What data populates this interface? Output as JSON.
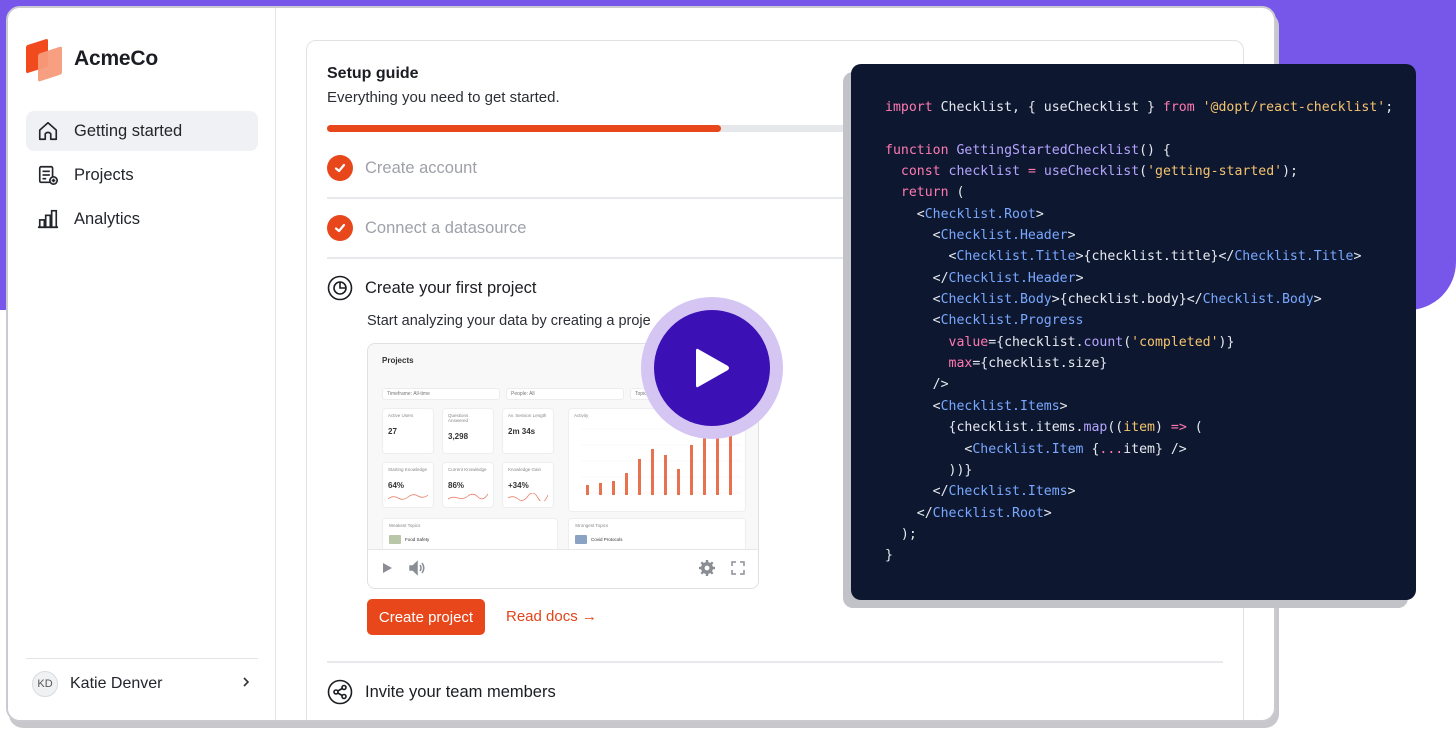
{
  "brand": {
    "name": "AcmeCo",
    "primary_color": "#e8471b",
    "accent_purple": "#7757ea"
  },
  "sidebar": {
    "items": [
      {
        "label": "Getting started",
        "icon": "home-icon",
        "active": true
      },
      {
        "label": "Projects",
        "icon": "document-list-icon",
        "active": false
      },
      {
        "label": "Analytics",
        "icon": "bar-chart-icon",
        "active": false
      }
    ],
    "user": {
      "initials": "KD",
      "name": "Katie Denver"
    }
  },
  "setup": {
    "title": "Setup guide",
    "subtitle": "Everything you need to get started.",
    "progress_fraction": 0.44,
    "steps": [
      {
        "label": "Create account",
        "status": "done"
      },
      {
        "label": "Connect a datasource",
        "status": "done"
      },
      {
        "label": "Create your first project",
        "status": "current",
        "description": "Start analyzing your data by creating a proje"
      },
      {
        "label": "Invite your team members",
        "status": "todo"
      }
    ],
    "primary_button": "Create project",
    "docs_link": "Read docs →"
  },
  "video": {
    "preview": {
      "title": "Projects",
      "filters": [
        "Timeframe: All-time",
        "People: All",
        "Topic"
      ],
      "stats": [
        {
          "label": "Active Users",
          "value": "27"
        },
        {
          "label": "Questions Answered",
          "value": "3,298"
        },
        {
          "label": "Av. Session Length",
          "value": "2m 34s"
        },
        {
          "label": "Starting Knowledge",
          "value": "64%"
        },
        {
          "label": "Current Knowledge",
          "value": "86%"
        },
        {
          "label": "Knowledge Gain",
          "value": "+34%"
        }
      ],
      "activity_label": "Activity",
      "weakest_label": "Weakest Topics",
      "weakest_item": "Food Safety",
      "strongest_label": "Strongest Topics",
      "strongest_item": "Covid Protocols"
    },
    "controls": [
      "play-icon",
      "volume-icon",
      "settings-icon",
      "fullscreen-icon"
    ]
  },
  "code_lines": [
    [
      [
        "kw",
        "import"
      ],
      [
        "pl",
        " Checklist, { useChecklist } "
      ],
      [
        "kw",
        "from"
      ],
      [
        "pl",
        " "
      ],
      [
        "str",
        "'@dopt/react-checklist'"
      ],
      [
        "pl",
        ";"
      ]
    ],
    [],
    [
      [
        "kw",
        "function"
      ],
      [
        "pl",
        " "
      ],
      [
        "fn",
        "GettingStartedChecklist"
      ],
      [
        "pl",
        "() {"
      ]
    ],
    [
      [
        "pl",
        "  "
      ],
      [
        "kw",
        "const"
      ],
      [
        "pl",
        " "
      ],
      [
        "fn",
        "checklist"
      ],
      [
        "pl",
        " "
      ],
      [
        "kw",
        "="
      ],
      [
        "pl",
        " "
      ],
      [
        "fn",
        "useChecklist"
      ],
      [
        "pl",
        "("
      ],
      [
        "str",
        "'getting-started'"
      ],
      [
        "pl",
        ");"
      ]
    ],
    [
      [
        "pl",
        "  "
      ],
      [
        "kw",
        "return"
      ],
      [
        "pl",
        " ("
      ]
    ],
    [
      [
        "pl",
        "    <"
      ],
      [
        "tag",
        "Checklist.Root"
      ],
      [
        "pl",
        ">"
      ]
    ],
    [
      [
        "pl",
        "      <"
      ],
      [
        "tag",
        "Checklist.Header"
      ],
      [
        "pl",
        ">"
      ]
    ],
    [
      [
        "pl",
        "        <"
      ],
      [
        "tag",
        "Checklist.Title"
      ],
      [
        "pl",
        ">{checklist.title}</"
      ],
      [
        "tag",
        "Checklist.Title"
      ],
      [
        "pl",
        ">"
      ]
    ],
    [
      [
        "pl",
        "      </"
      ],
      [
        "tag",
        "Checklist.Header"
      ],
      [
        "pl",
        ">"
      ]
    ],
    [
      [
        "pl",
        "      <"
      ],
      [
        "tag",
        "Checklist.Body"
      ],
      [
        "pl",
        ">{checklist.body}</"
      ],
      [
        "tag",
        "Checklist.Body"
      ],
      [
        "pl",
        ">"
      ]
    ],
    [
      [
        "pl",
        "      <"
      ],
      [
        "tag",
        "Checklist.Progress"
      ]
    ],
    [
      [
        "pl",
        "        "
      ],
      [
        "attr",
        "value"
      ],
      [
        "pl",
        "={checklist."
      ],
      [
        "fn",
        "count"
      ],
      [
        "pl",
        "("
      ],
      [
        "str",
        "'completed'"
      ],
      [
        "pl",
        ")}"
      ]
    ],
    [
      [
        "pl",
        "        "
      ],
      [
        "attr",
        "max"
      ],
      [
        "pl",
        "={checklist.size}"
      ]
    ],
    [
      [
        "pl",
        "      />"
      ]
    ],
    [
      [
        "pl",
        "      <"
      ],
      [
        "tag",
        "Checklist.Items"
      ],
      [
        "pl",
        ">"
      ]
    ],
    [
      [
        "pl",
        "        {checklist.items."
      ],
      [
        "fn",
        "map"
      ],
      [
        "pl",
        "(("
      ],
      [
        "str",
        "item"
      ],
      [
        "pl",
        ") "
      ],
      [
        "kw",
        "=>"
      ],
      [
        "pl",
        " ("
      ]
    ],
    [
      [
        "pl",
        "          <"
      ],
      [
        "tag",
        "Checklist.Item"
      ],
      [
        "pl",
        " {"
      ],
      [
        "kw",
        "..."
      ],
      [
        "pl",
        "item} />"
      ]
    ],
    [
      [
        "pl",
        "        ))}"
      ]
    ],
    [
      [
        "pl",
        "      </"
      ],
      [
        "tag",
        "Checklist.Items"
      ],
      [
        "pl",
        ">"
      ]
    ],
    [
      [
        "pl",
        "    </"
      ],
      [
        "tag",
        "Checklist.Root"
      ],
      [
        "pl",
        ">"
      ]
    ],
    [
      [
        "pl",
        "  );"
      ]
    ],
    [
      [
        "pl",
        "}"
      ]
    ]
  ],
  "code_colors": {
    "keyword": "#ff79b0",
    "function": "#b6a4ff",
    "string": "#f5c36e",
    "tag": "#7aa7ff",
    "background": "#0d1830"
  }
}
